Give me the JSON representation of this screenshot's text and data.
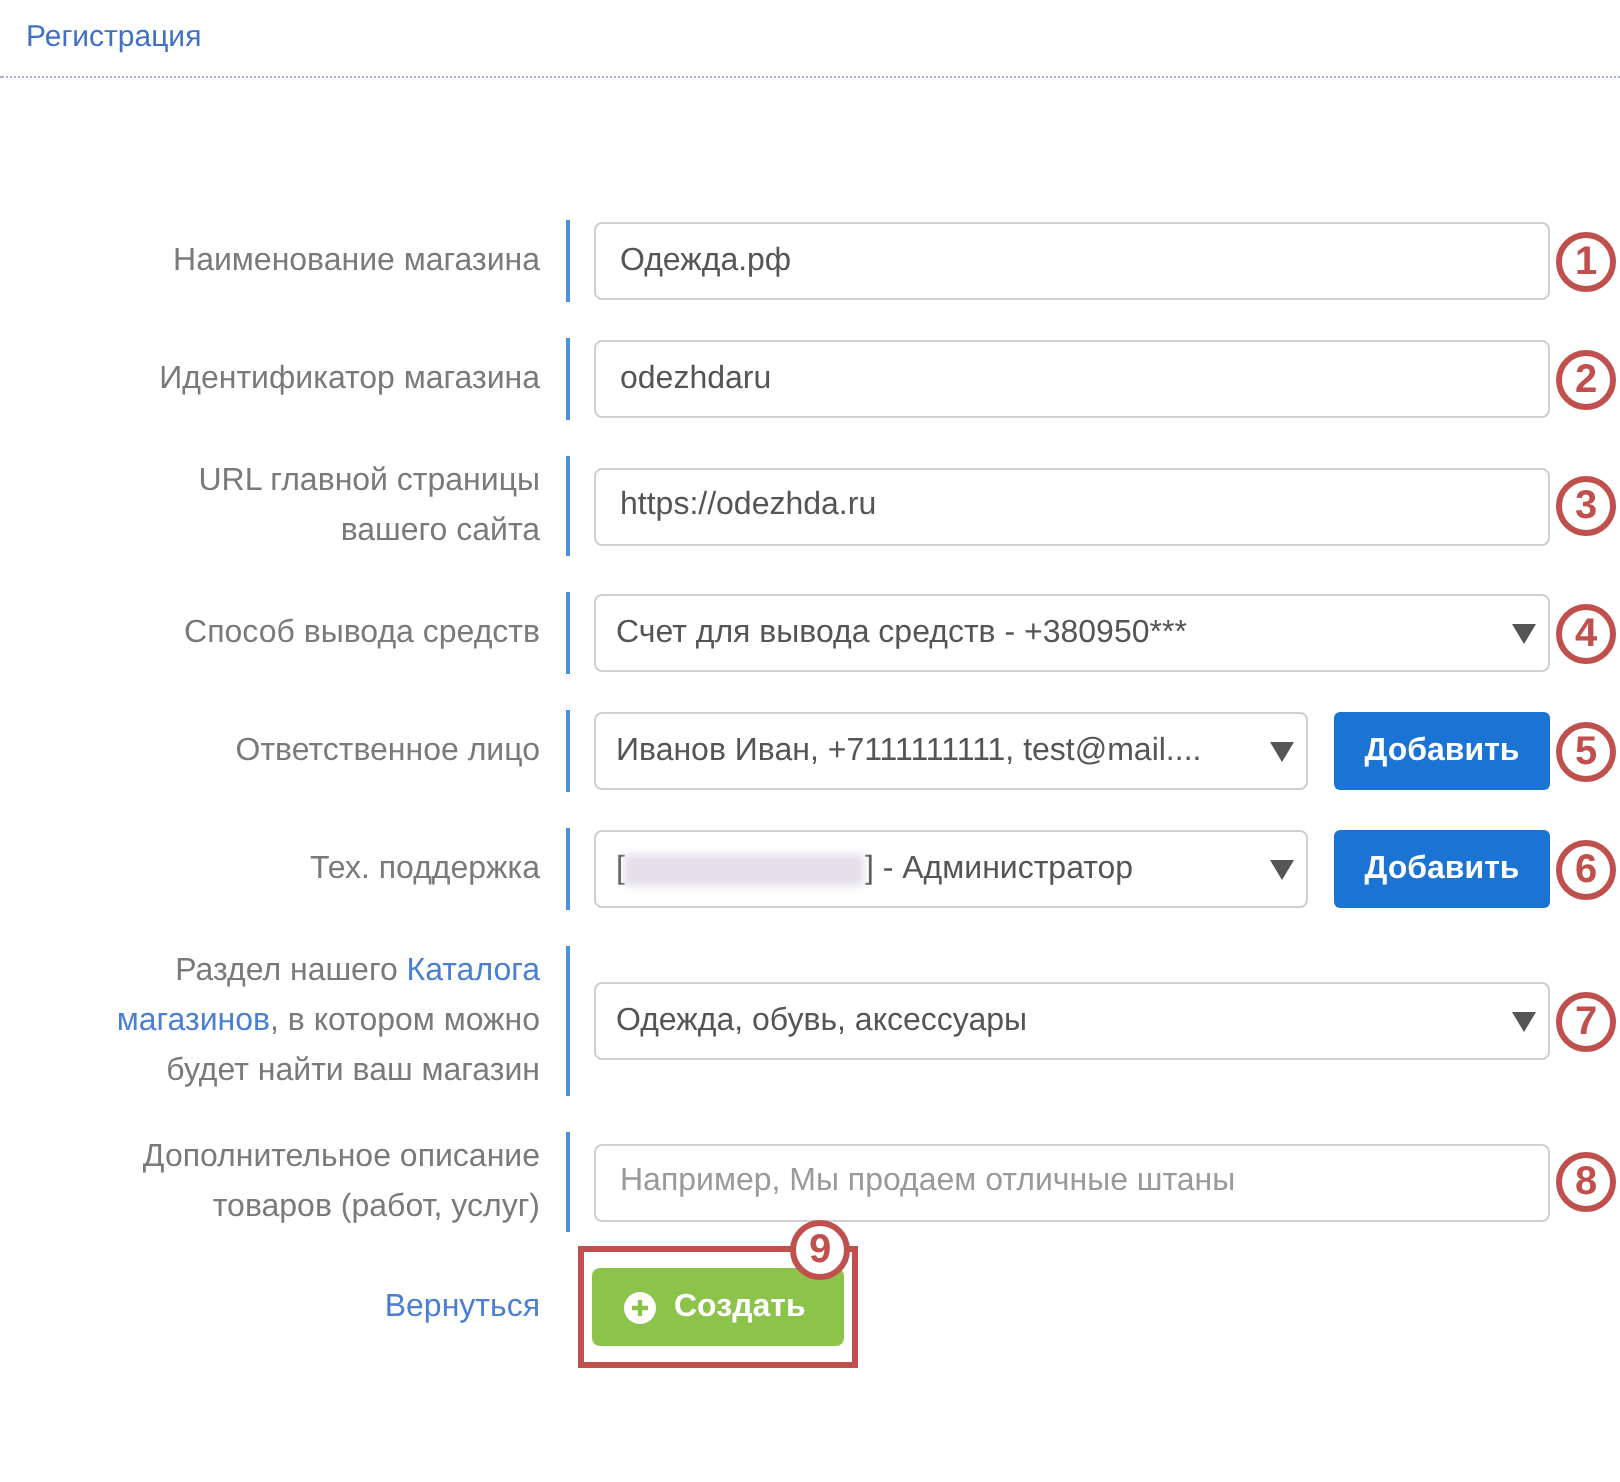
{
  "header": {
    "title": "Регистрация"
  },
  "form": {
    "rows": [
      {
        "kind": "input",
        "label": "Наименование магазина",
        "value": "Одежда.рф",
        "marker": "1"
      },
      {
        "kind": "input",
        "label": "Идентификатор магазина",
        "value": "odezhdaru",
        "marker": "2"
      },
      {
        "kind": "input",
        "label": "URL главной страницы вашего сайта",
        "value": "https://odezhda.ru",
        "marker": "3"
      },
      {
        "kind": "select",
        "label": "Способ вывода средств",
        "value": "Счет для вывода средств - +380950***",
        "marker": "4"
      },
      {
        "kind": "select",
        "label": "Ответственное лицо",
        "value": "Иванов Иван, +7111111111, test@mail....",
        "button": "Добавить",
        "marker": "5"
      },
      {
        "kind": "select",
        "label": "Тех. поддержка",
        "value_before": "[",
        "redacted": true,
        "value_after": "] - Администратор",
        "button": "Добавить",
        "marker": "6"
      },
      {
        "kind": "select",
        "label_parts": [
          {
            "kind": "text",
            "text": "Раздел нашего "
          },
          {
            "kind": "link",
            "text": "Каталога"
          },
          {
            "kind": "link",
            "text": "магазинов"
          },
          {
            "kind": "text",
            "text": ", в котором можно будет найти ваш магазин"
          }
        ],
        "value": "Одежда, обувь, аксессуары",
        "marker": "7"
      },
      {
        "kind": "input",
        "label": "Дополнительное описание товаров (работ, услуг)",
        "placeholder": "Например, Мы продаем отличные штаны",
        "marker": "8"
      }
    ]
  },
  "actions": {
    "back_link": "Вернуться",
    "submit": {
      "label": "Создать",
      "highlighted": true,
      "marker": "9"
    }
  }
}
